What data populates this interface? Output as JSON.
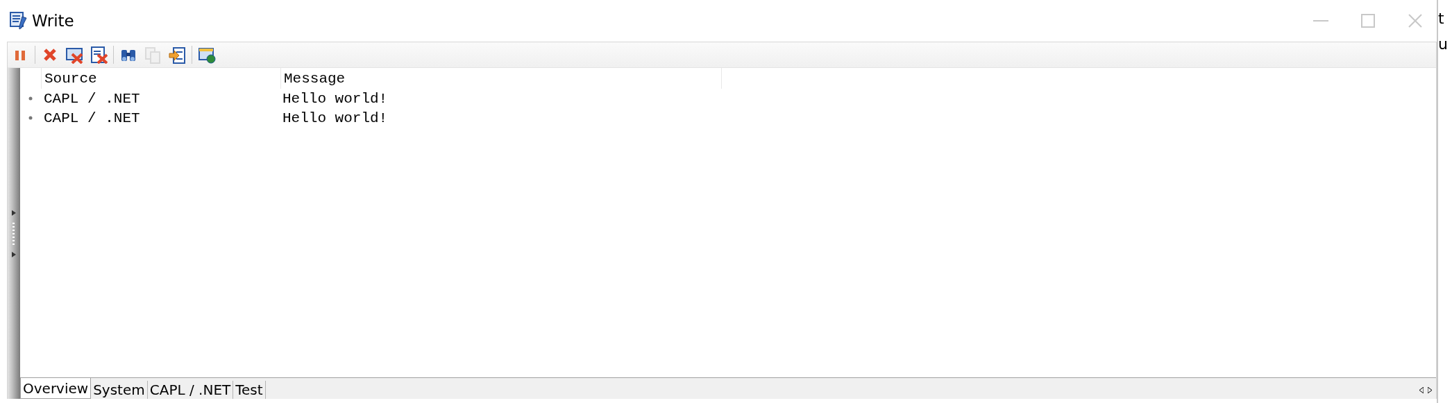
{
  "window": {
    "title": "Write"
  },
  "toolbar": {
    "buttons": [
      {
        "kind": "pause",
        "disabled": false
      },
      {
        "kind": "delete",
        "disabled": false
      },
      {
        "kind": "delete-window",
        "disabled": false
      },
      {
        "kind": "delete-document",
        "disabled": false
      },
      {
        "kind": "find",
        "disabled": false
      },
      {
        "kind": "copy",
        "disabled": true
      },
      {
        "kind": "export",
        "disabled": false
      },
      {
        "kind": "window-globe",
        "disabled": false
      }
    ]
  },
  "table": {
    "columns": [
      "Source",
      "Message"
    ],
    "rows": [
      {
        "source": "CAPL / .NET",
        "message": "Hello world!"
      },
      {
        "source": "CAPL / .NET",
        "message": "Hello world!"
      }
    ]
  },
  "tabs": [
    {
      "label": "Overview",
      "selected": true
    },
    {
      "label": "System",
      "selected": false
    },
    {
      "label": "CAPL / .NET",
      "selected": false
    },
    {
      "label": "Test",
      "selected": false
    }
  ],
  "background_window": {
    "fragments": [
      "t",
      "u"
    ]
  }
}
